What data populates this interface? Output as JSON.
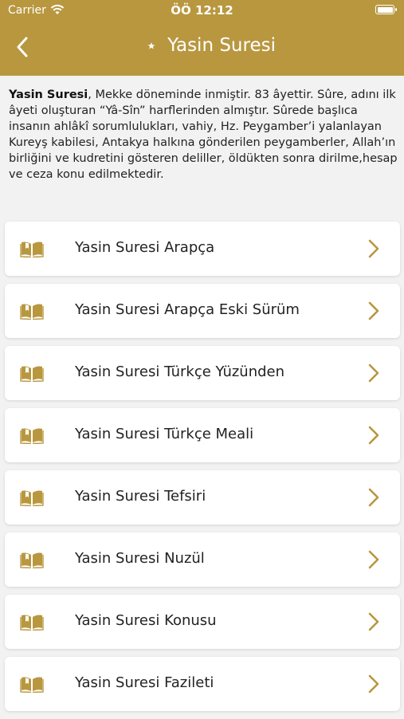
{
  "status": {
    "carrier": "Carrier",
    "time": "ÖÖ 12:12"
  },
  "header": {
    "title": "Yasin Suresi"
  },
  "intro": {
    "bold": "Yasin Suresi",
    "text": ", Mekke döneminde inmiştir. 83 âyettir. Sûre, adını ilk âyeti oluşturan “Yâ-Sîn” harflerinden almıştır. Sûrede başlıca insanın ahlâkî sorumlulukları, vahiy, Hz. Peygamber’i yalanlayan Kureyş kabilesi, Antakya halkına gönderilen peygamberler, Allah’ın birliğini ve kudretini gösteren deliller, öldükten sonra dirilme,hesap ve ceza konu edilmektedir."
  },
  "items": [
    {
      "label": "Yasin Suresi Arapça"
    },
    {
      "label": "Yasin Suresi Arapça Eski Sürüm"
    },
    {
      "label": "Yasin Suresi Türkçe Yüzünden"
    },
    {
      "label": "Yasin Suresi Türkçe Meali"
    },
    {
      "label": "Yasin Suresi Tefsiri"
    },
    {
      "label": "Yasin Suresi Nuzül"
    },
    {
      "label": "Yasin Suresi Konusu"
    },
    {
      "label": "Yasin Suresi Fazileti"
    }
  ],
  "colors": {
    "accent": "#b8973f",
    "icon": "#b8973f",
    "background": "#f2f2f2"
  },
  "icons": {
    "back": "chevron-left-icon",
    "title": "crescent-star-icon",
    "item": "open-book-icon",
    "disclosure": "chevron-right-icon"
  }
}
